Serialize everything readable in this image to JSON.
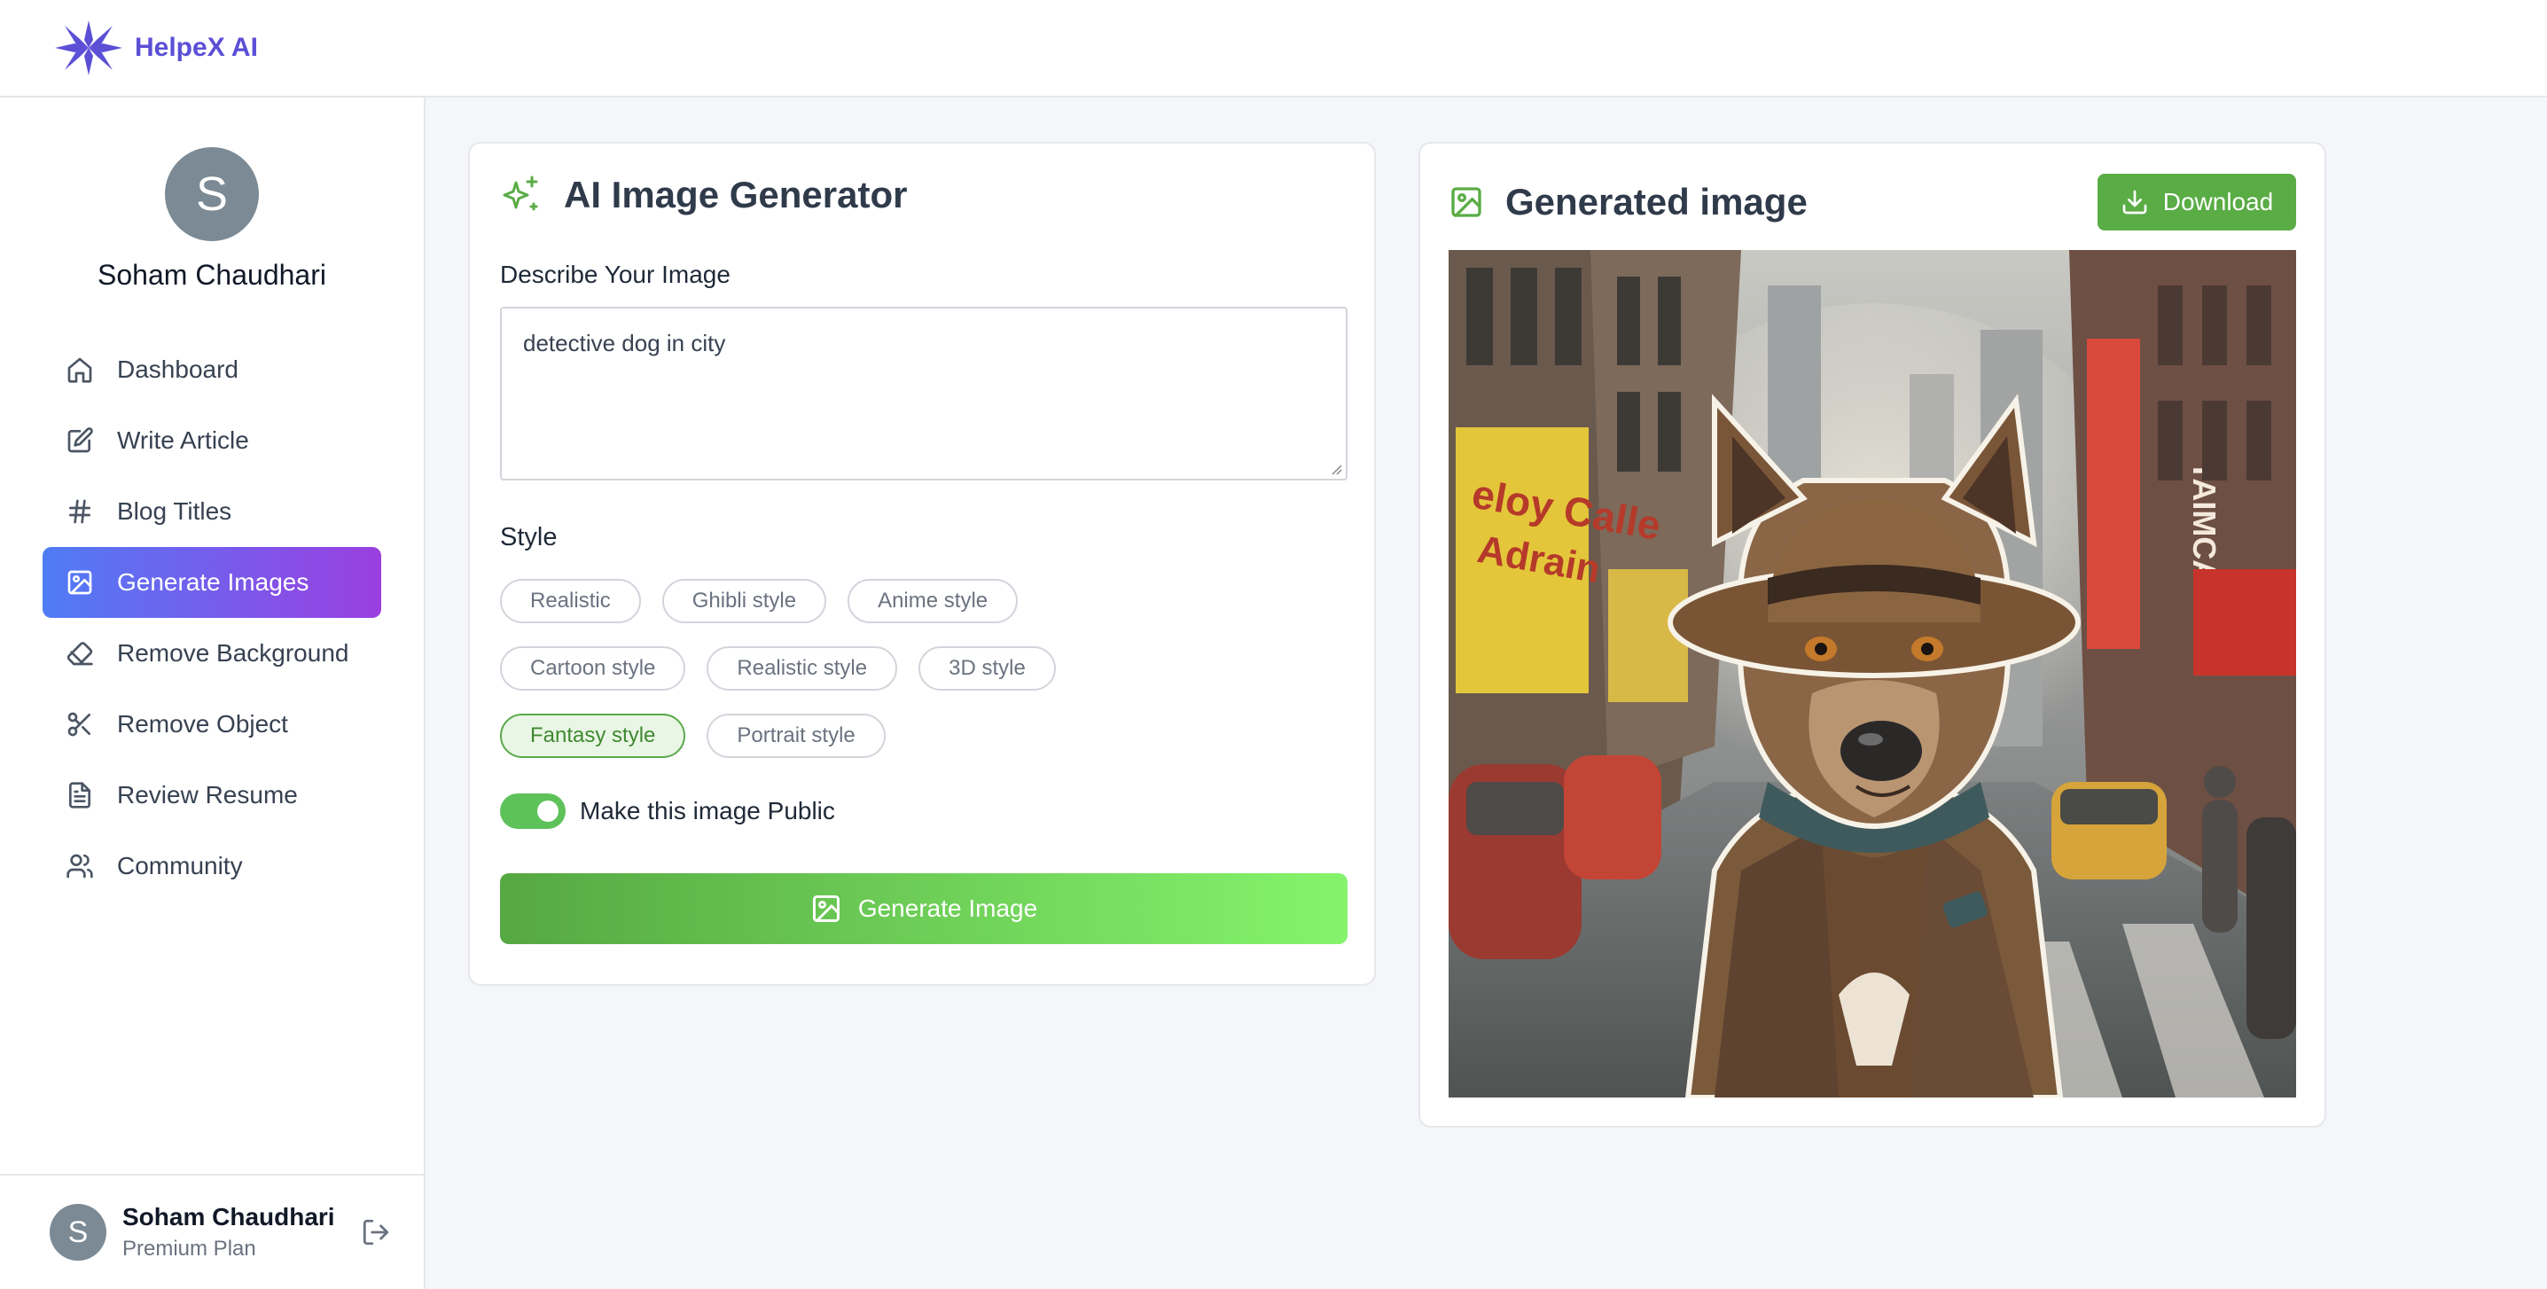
{
  "app": {
    "name": "HelpeX AI"
  },
  "user": {
    "name": "Soham Chaudhari",
    "initial": "S",
    "plan": "Premium Plan"
  },
  "sidebar": {
    "items": [
      {
        "label": "Dashboard",
        "icon": "home-icon"
      },
      {
        "label": "Write Article",
        "icon": "edit-icon"
      },
      {
        "label": "Blog Titles",
        "icon": "hash-icon"
      },
      {
        "label": "Generate Images",
        "icon": "image-icon",
        "active": true
      },
      {
        "label": "Remove Background",
        "icon": "eraser-icon"
      },
      {
        "label": "Remove Object",
        "icon": "scissors-icon"
      },
      {
        "label": "Review Resume",
        "icon": "file-text-icon"
      },
      {
        "label": "Community",
        "icon": "users-icon"
      }
    ]
  },
  "generator": {
    "title": "AI Image Generator",
    "describe_label": "Describe Your Image",
    "prompt_value": "detective dog in city",
    "style_label": "Style",
    "styles": [
      [
        "Realistic",
        "Ghibli style",
        "Anime style"
      ],
      [
        "Cartoon style",
        "Realistic style",
        "3D style"
      ],
      [
        "Fantasy style",
        "Portrait style"
      ]
    ],
    "selected_style": "Fantasy style",
    "public_toggle_label": "Make this image Public",
    "public_toggle_on": true,
    "generate_button": "Generate Image"
  },
  "result": {
    "title": "Generated image",
    "download_button": "Download"
  },
  "colors": {
    "brand": "#5b4fd6",
    "nav_active_start": "#4f7cf6",
    "nav_active_end": "#9b3fe0",
    "green": "#5aac45"
  }
}
